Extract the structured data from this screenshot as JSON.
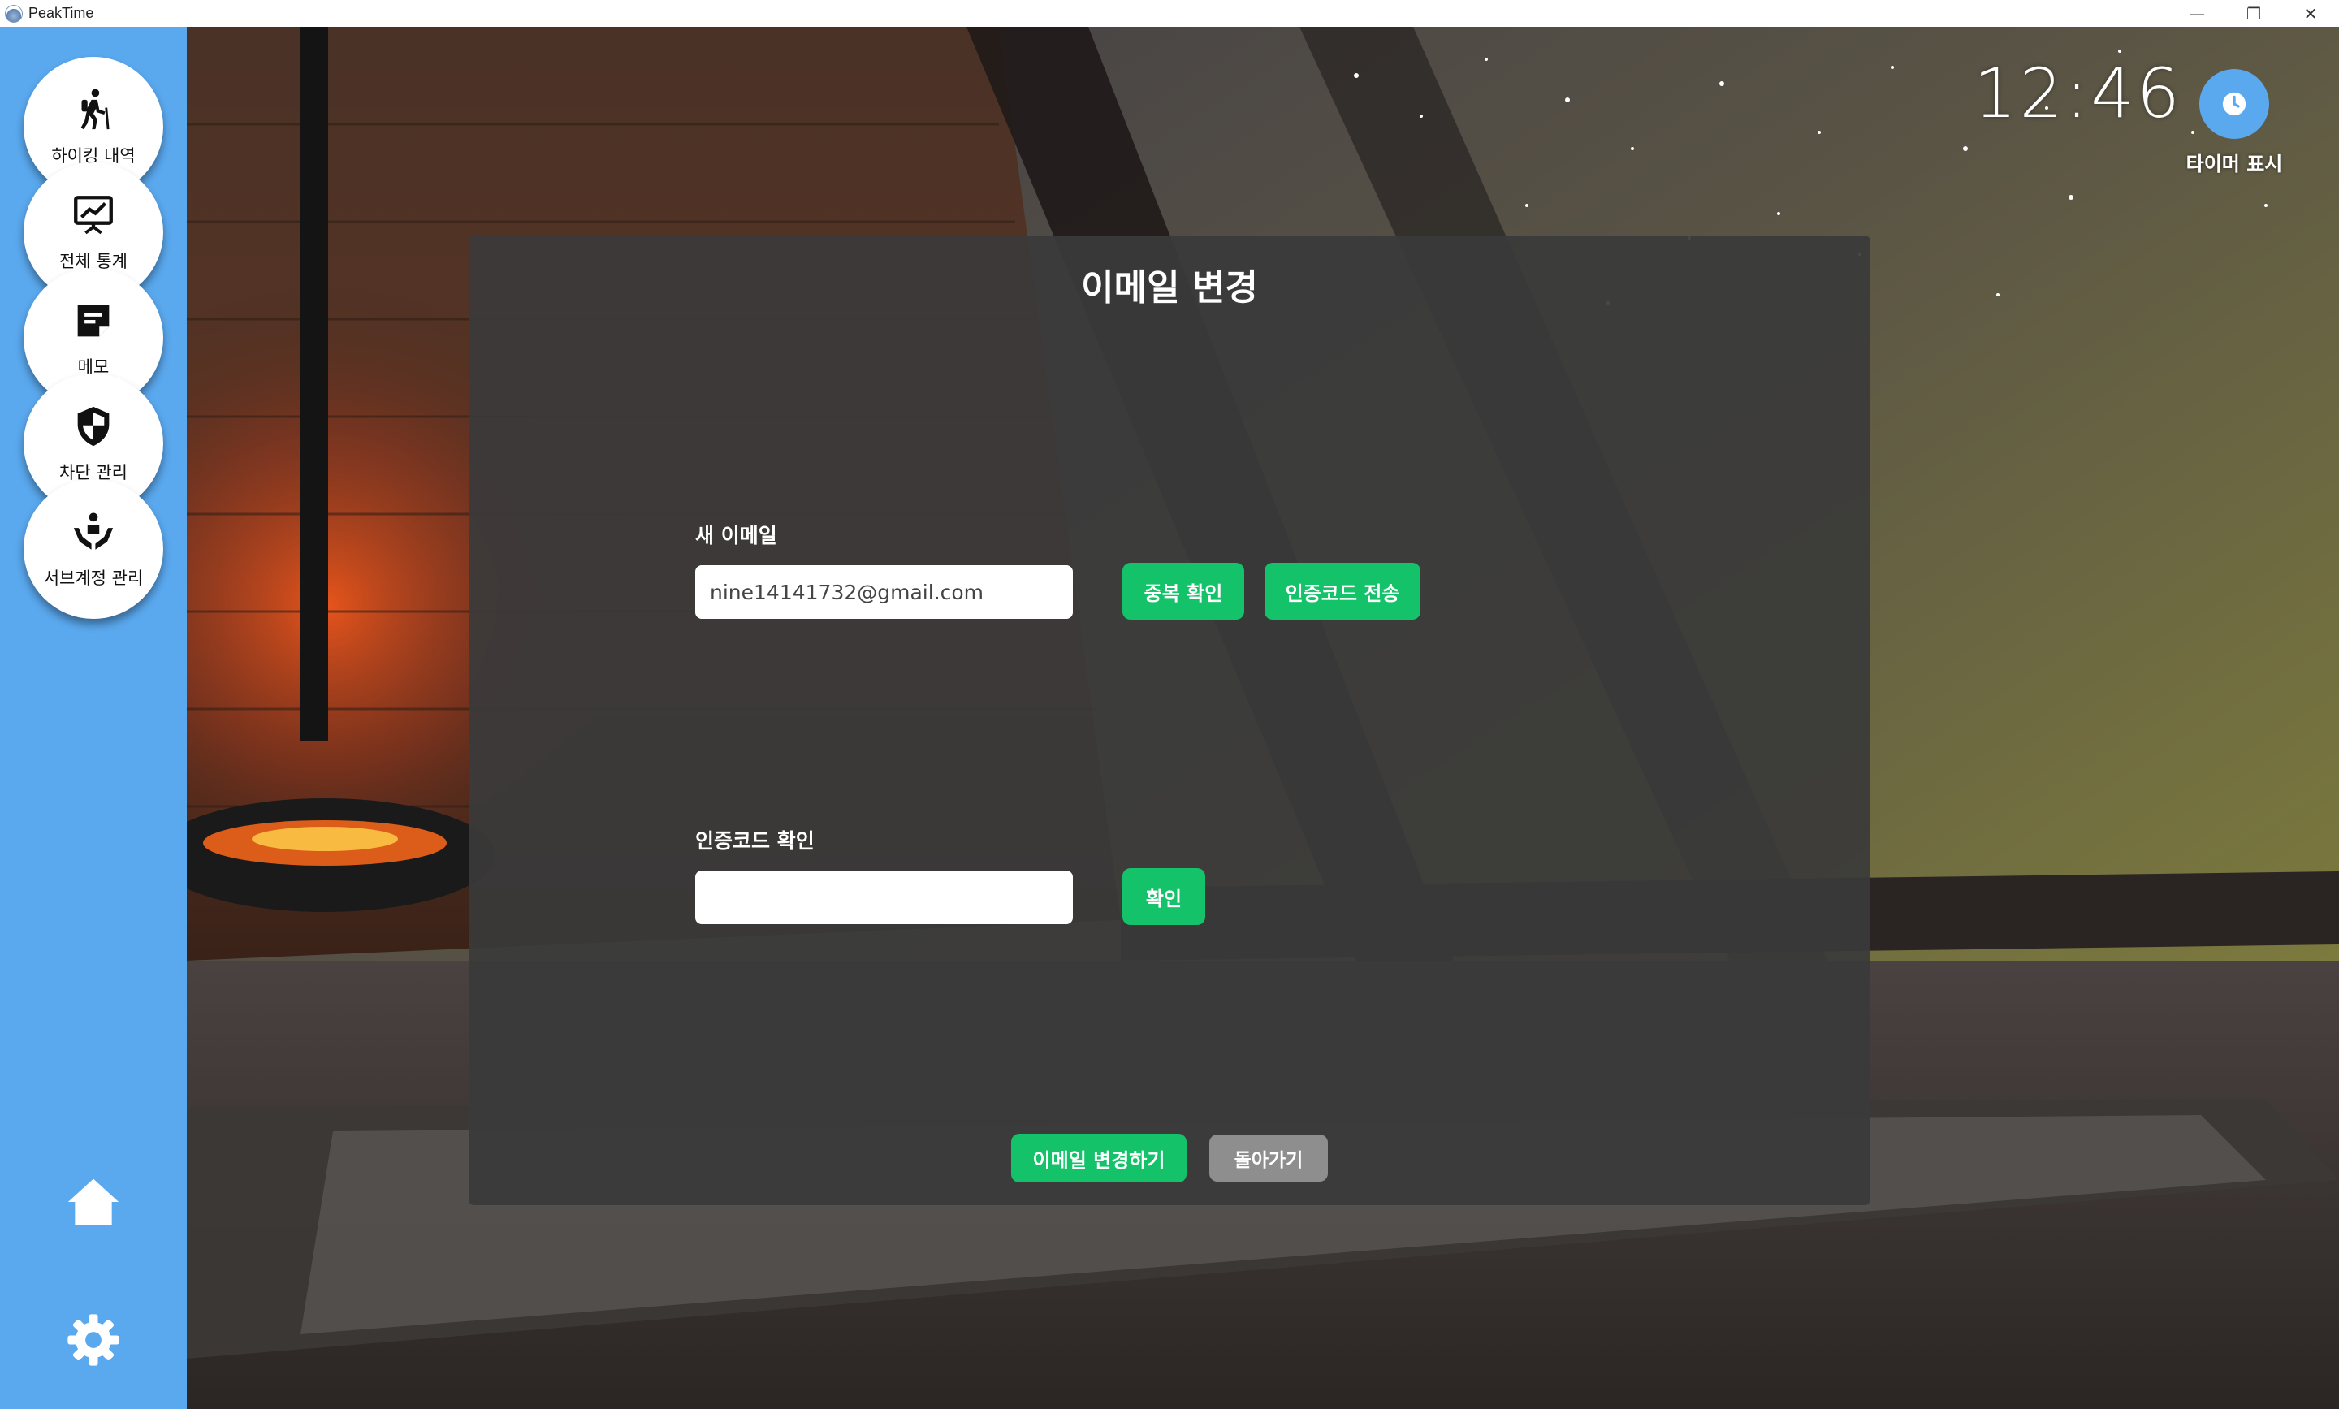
{
  "window": {
    "title": "PeakTime",
    "controls": {
      "minimize": "—",
      "restore": "❐",
      "close": "✕"
    }
  },
  "sidebar": {
    "items": [
      {
        "label": "하이킹 내역",
        "icon": "hiking-icon"
      },
      {
        "label": "전체 통계",
        "icon": "statistics-board-icon"
      },
      {
        "label": "메모",
        "icon": "memo-icon"
      },
      {
        "label": "차단 관리",
        "icon": "shield-icon"
      },
      {
        "label": "서브계정 관리",
        "icon": "sub-account-hands-icon"
      }
    ],
    "home_icon": "home-icon",
    "settings_icon": "gear-icon"
  },
  "clock": {
    "time": "12:46",
    "timer_label": "타이머 표시",
    "timer_icon": "clock-icon"
  },
  "dialog": {
    "title": "이메일 변경",
    "new_email": {
      "label": "새 이메일",
      "value": "nine14141732@gmail.com",
      "duplicate_check_button": "중복 확인",
      "send_code_button": "인증코드 전송"
    },
    "verify_code": {
      "label": "인증코드 확인",
      "value": "",
      "confirm_button": "확인"
    },
    "submit_button": "이메일 변경하기",
    "back_button": "돌아가기"
  },
  "colors": {
    "sidebar": "#5aa8ee",
    "accent_green": "#14c26a",
    "dialog_bg": "#3a3a3a",
    "back_button": "#8e8e8e"
  }
}
